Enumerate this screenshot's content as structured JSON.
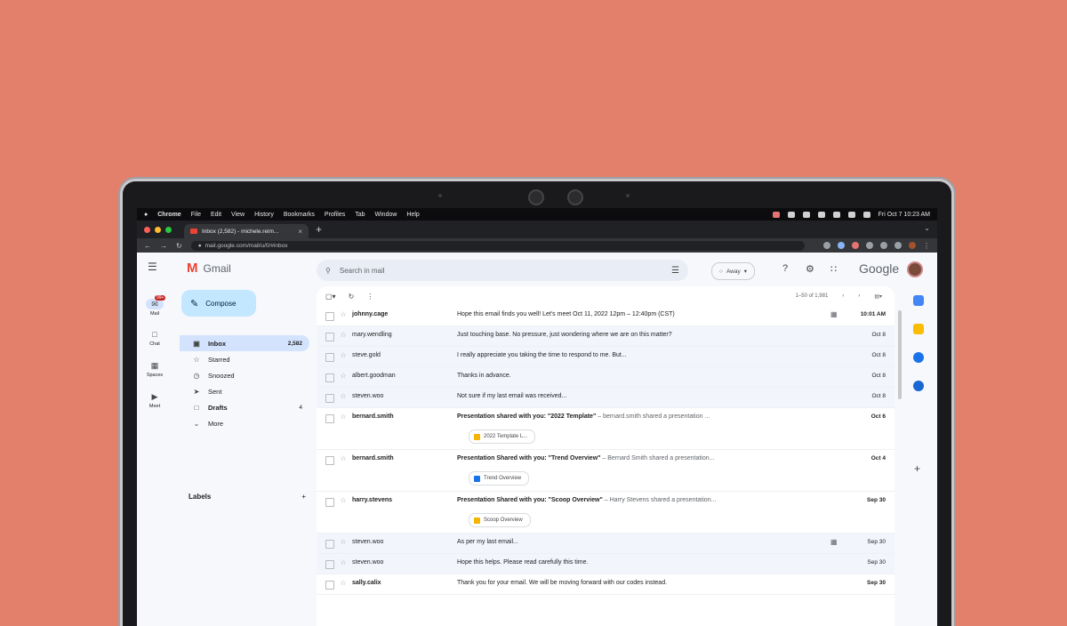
{
  "menubar": {
    "apple": "",
    "items": [
      "Chrome",
      "File",
      "Edit",
      "View",
      "History",
      "Bookmarks",
      "Profiles",
      "Tab",
      "Window",
      "Help"
    ],
    "clock": "Fri Oct 7  10:23 AM"
  },
  "browser": {
    "tab_title": "Inbox (2,582) - michele.reim...",
    "url": "mail.google.com/mail/u/0/#inbox"
  },
  "gmail": {
    "product_name": "Gmail",
    "compose_label": "Compose",
    "search_placeholder": "Search in mail",
    "status_label": "Away",
    "brand_word": "Google",
    "rail": [
      {
        "label": "Mail",
        "badge": "99+"
      },
      {
        "label": "Chat"
      },
      {
        "label": "Spaces"
      },
      {
        "label": "Meet"
      }
    ],
    "nav": [
      {
        "label": "Inbox",
        "count": "2,582"
      },
      {
        "label": "Starred",
        "count": ""
      },
      {
        "label": "Snoozed",
        "count": ""
      },
      {
        "label": "Sent",
        "count": ""
      },
      {
        "label": "Drafts",
        "count": "4"
      },
      {
        "label": "More",
        "count": ""
      }
    ],
    "labels_heading": "Labels",
    "labels_add": "+",
    "pager_text": "1–50 of 1,981"
  },
  "emails": [
    {
      "sender": "johnny.cage",
      "body": "Hope this email finds you well! Let's meet Oct 11, 2022 12pm – 12:40pm (CST)",
      "date": "10:01 AM",
      "cal": true
    },
    {
      "sender": "mary.wendling",
      "body": "Just touching base. No pressure, just wondering where we are on this matter?",
      "date": "Oct 8"
    },
    {
      "sender": "steve.gold",
      "body": "I really appreciate you taking the time to respond to me. But...",
      "date": "Oct 8"
    },
    {
      "sender": "albert.goodman",
      "body": "Thanks in advance.",
      "date": "Oct 8"
    },
    {
      "sender": "steven.woo",
      "body": "Not sure if my last email was received...",
      "date": "Oct 8"
    },
    {
      "sender": "bernard.smith",
      "subject": "Presentation shared with you: \"2022 Template\"",
      "snippet": " – bernard.smith shared a presentation ...",
      "date": "Oct 6",
      "attach": "2022 Template L...",
      "attach_color": "#f4b400"
    },
    {
      "sender": "bernard.smith",
      "subject": "Presentation Shared with you: \"Trend Overview\"",
      "snippet": " – Bernard Smith shared a presentation...",
      "date": "Oct 4",
      "attach": "Trend Overview",
      "attach_color": "#1a73e8"
    },
    {
      "sender": "harry.stevens",
      "subject": "Presentation Shared with you: \"Scoop Overview\"",
      "snippet": " – Harry Stevens shared a presentation...",
      "date": "Sep 30",
      "attach": "Scoop Overview",
      "attach_color": "#f4b400"
    },
    {
      "sender": "steven.woo",
      "body": "As per my last email...",
      "date": "Sep 30",
      "cal": true
    },
    {
      "sender": "steven.woo",
      "body": "Hope this helps. Please read carefully this time.",
      "date": "Sep 30"
    },
    {
      "sender": "sally.calix",
      "body": "Thank you for your email. We will be moving forward with our codes instead.",
      "date": "Sep 30"
    }
  ],
  "colors": {
    "background": "#e3806c",
    "compose": "#c2e7ff",
    "inbox_active": "#d3e3fd",
    "gmail_red": "#ea4335"
  }
}
